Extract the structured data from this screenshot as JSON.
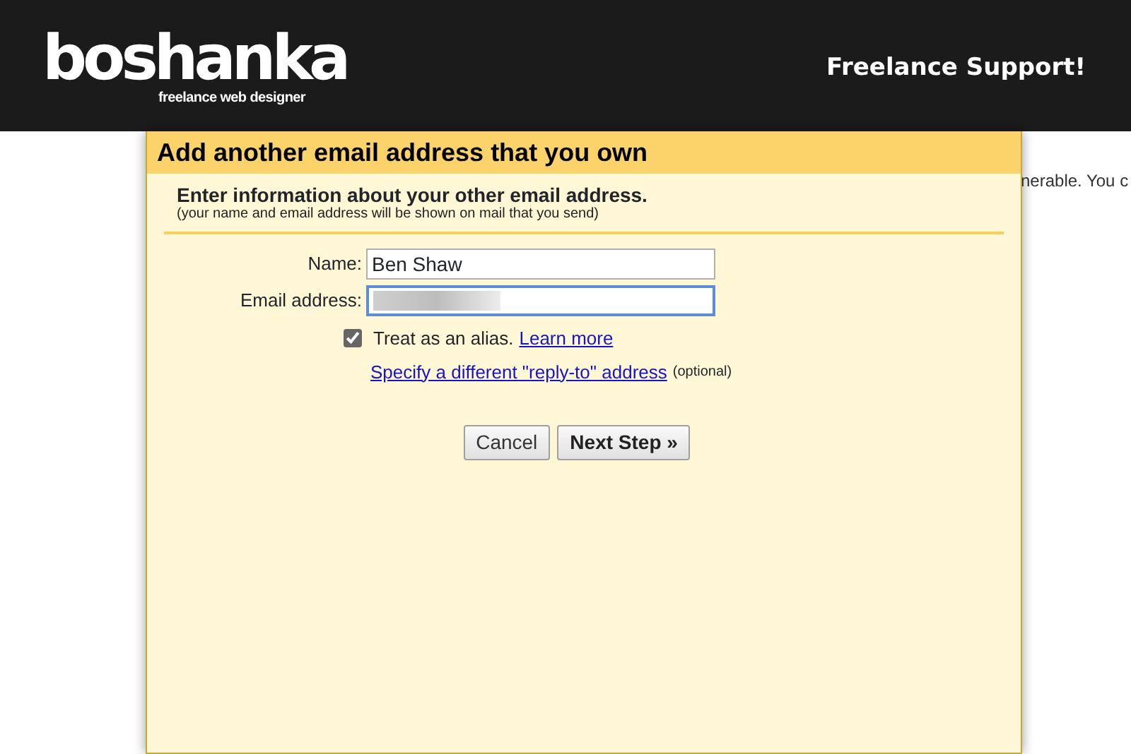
{
  "header": {
    "logo": "boshanka",
    "logo_tagline": "freelance web designer",
    "title": "Freelance Support!"
  },
  "background_text": "nerable. You c",
  "dialog": {
    "title": "Add another email address that you own",
    "heading": "Enter information about your other email address.",
    "subheading": "(your name and email address will be shown on mail that you send)",
    "fields": [
      {
        "label": "Name:",
        "value": "Ben Shaw",
        "focused": false,
        "redacted": false
      },
      {
        "label": "Email address:",
        "focused": true,
        "redacted": true
      }
    ],
    "alias": {
      "label": "Treat as an alias.",
      "link": "Learn more",
      "checked": true
    },
    "reply_to": {
      "link": "Specify a different \"reply-to\" address",
      "note": "(optional)"
    },
    "buttons": [
      {
        "label": "Cancel",
        "primary": false
      },
      {
        "label": "Next Step »",
        "primary": true
      }
    ]
  }
}
